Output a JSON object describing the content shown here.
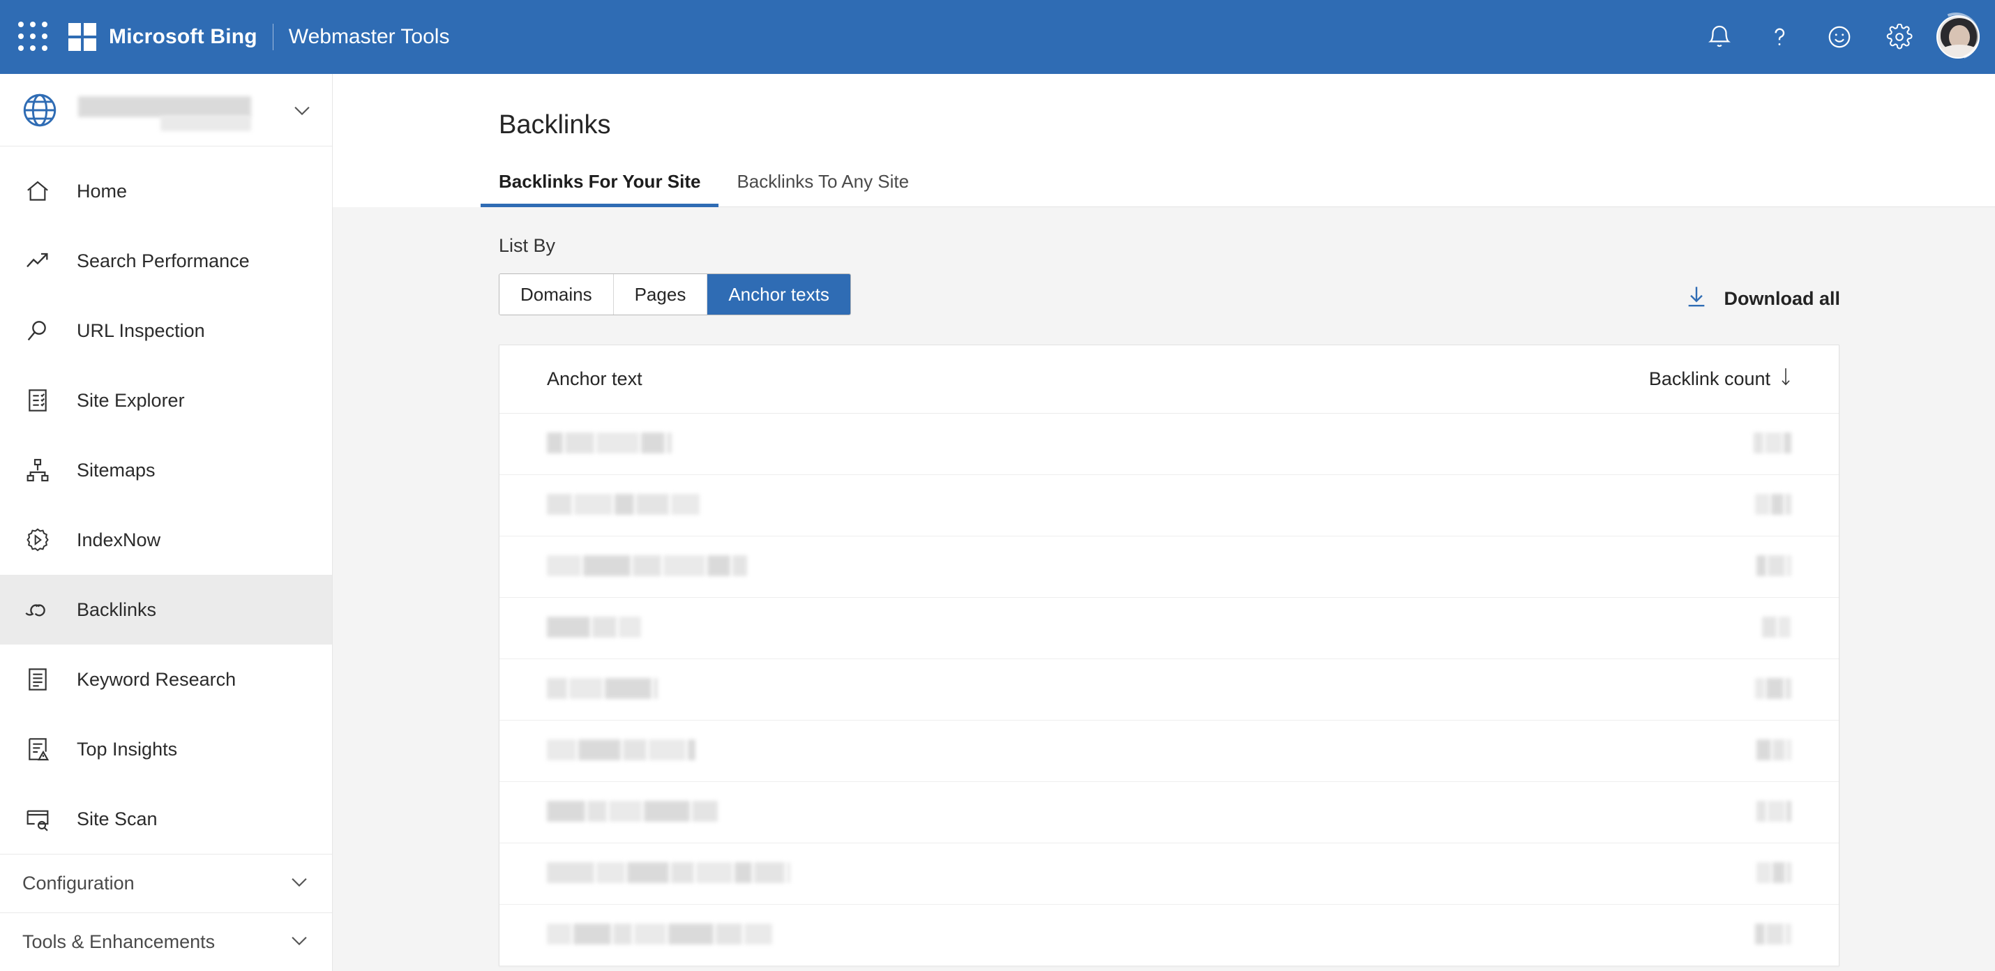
{
  "header": {
    "waffle_icon": "app-launcher-icon",
    "logo_icon": "microsoft-logo-icon",
    "brand": "Microsoft Bing",
    "suite": "Webmaster Tools",
    "icons": [
      {
        "name": "notifications-icon",
        "glyph": "bell"
      },
      {
        "name": "help-icon",
        "glyph": "question"
      },
      {
        "name": "feedback-icon",
        "glyph": "smiley"
      },
      {
        "name": "settings-icon",
        "glyph": "gear"
      }
    ],
    "avatar_name": "user-avatar",
    "background_color": "#2f6cb4"
  },
  "sidebar": {
    "site_picker": {
      "icon": "globe-icon",
      "site_name": "",
      "redacted": true,
      "chevron": "chevron-down-icon"
    },
    "items": [
      {
        "label": "Home",
        "icon": "home-icon",
        "active": false
      },
      {
        "label": "Search Performance",
        "icon": "trending-up-icon",
        "active": false
      },
      {
        "label": "URL Inspection",
        "icon": "search-icon",
        "active": false
      },
      {
        "label": "Site Explorer",
        "icon": "checklist-icon",
        "active": false
      },
      {
        "label": "Sitemaps",
        "icon": "sitemap-icon",
        "active": false
      },
      {
        "label": "IndexNow",
        "icon": "indexnow-gear-icon",
        "active": false
      },
      {
        "label": "Backlinks",
        "icon": "link-icon",
        "active": true
      },
      {
        "label": "Keyword Research",
        "icon": "document-list-icon",
        "active": false
      },
      {
        "label": "Top Insights",
        "icon": "insights-icon",
        "active": false
      },
      {
        "label": "Site Scan",
        "icon": "scan-icon",
        "active": false
      }
    ],
    "groups": [
      {
        "label": "Configuration",
        "chevron": "chevron-down-icon"
      },
      {
        "label": "Tools & Enhancements",
        "chevron": "chevron-down-icon"
      }
    ]
  },
  "main": {
    "page_title": "Backlinks",
    "tabs": [
      {
        "label": "Backlinks For Your Site",
        "active": true
      },
      {
        "label": "Backlinks To Any Site",
        "active": false
      }
    ],
    "list_by_label": "List By",
    "segments": [
      {
        "label": "Domains",
        "selected": false
      },
      {
        "label": "Pages",
        "selected": false
      },
      {
        "label": "Anchor texts",
        "selected": true
      }
    ],
    "download": {
      "label": "Download all",
      "icon": "download-icon",
      "accent": "#2f6cb4"
    },
    "table": {
      "columns": [
        {
          "label": "Anchor text",
          "align": "left"
        },
        {
          "label": "Backlink count",
          "align": "right",
          "sort": "desc",
          "sort_icon": "arrow-down-icon"
        }
      ],
      "rows": [
        {
          "anchor_text": "",
          "backlink_count": "",
          "redacted": true,
          "anchor_width": 182,
          "count_width": 56
        },
        {
          "anchor_text": "",
          "backlink_count": "",
          "redacted": true,
          "anchor_width": 222,
          "count_width": 54
        },
        {
          "anchor_text": "",
          "backlink_count": "",
          "redacted": true,
          "anchor_width": 290,
          "count_width": 52
        },
        {
          "anchor_text": "",
          "backlink_count": "",
          "redacted": true,
          "anchor_width": 138,
          "count_width": 44
        },
        {
          "anchor_text": "",
          "backlink_count": "",
          "redacted": true,
          "anchor_width": 162,
          "count_width": 54
        },
        {
          "anchor_text": "",
          "backlink_count": "",
          "redacted": true,
          "anchor_width": 216,
          "count_width": 52
        },
        {
          "anchor_text": "",
          "backlink_count": "",
          "redacted": true,
          "anchor_width": 248,
          "count_width": 52
        },
        {
          "anchor_text": "",
          "backlink_count": "",
          "redacted": true,
          "anchor_width": 352,
          "count_width": 52
        },
        {
          "anchor_text": "",
          "backlink_count": "",
          "redacted": true,
          "anchor_width": 326,
          "count_width": 54
        }
      ]
    }
  },
  "colors": {
    "accent": "#2f6cb4",
    "page_background": "#f4f4f4",
    "card_background": "#ffffff",
    "sidebar_active": "#ebebeb",
    "text_primary": "#252525"
  }
}
